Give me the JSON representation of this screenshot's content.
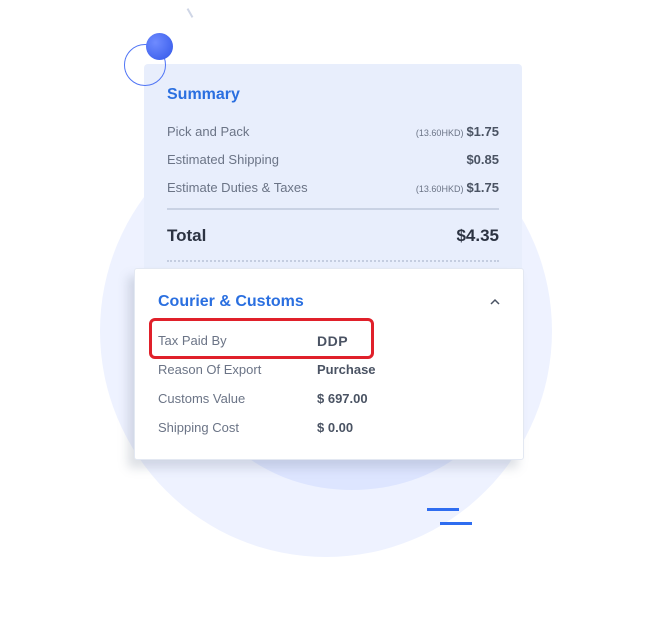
{
  "summary": {
    "title": "Summary",
    "rows": [
      {
        "label": "Pick and Pack",
        "note": "(13.60HKD)",
        "value": "$1.75"
      },
      {
        "label": "Estimated Shipping",
        "note": "",
        "value": "$0.85"
      },
      {
        "label": "Estimate Duties & Taxes",
        "note": "(13.60HKD)",
        "value": "$1.75"
      }
    ],
    "total_label": "Total",
    "total_value": "$4.35"
  },
  "courier": {
    "title": "Courier & Customs",
    "collapse_icon": "chevron-up-icon",
    "fields": [
      {
        "label": "Tax Paid By",
        "value": "DDP"
      },
      {
        "label": "Reason Of Export",
        "value": "Purchase"
      },
      {
        "label": "Customs Value",
        "value": "$ 697.00"
      },
      {
        "label": "Shipping Cost",
        "value": "$ 0.00"
      }
    ]
  },
  "colors": {
    "accent": "#2a6fe0",
    "highlight": "#e0202a",
    "summary_bg": "#e8eefc"
  }
}
